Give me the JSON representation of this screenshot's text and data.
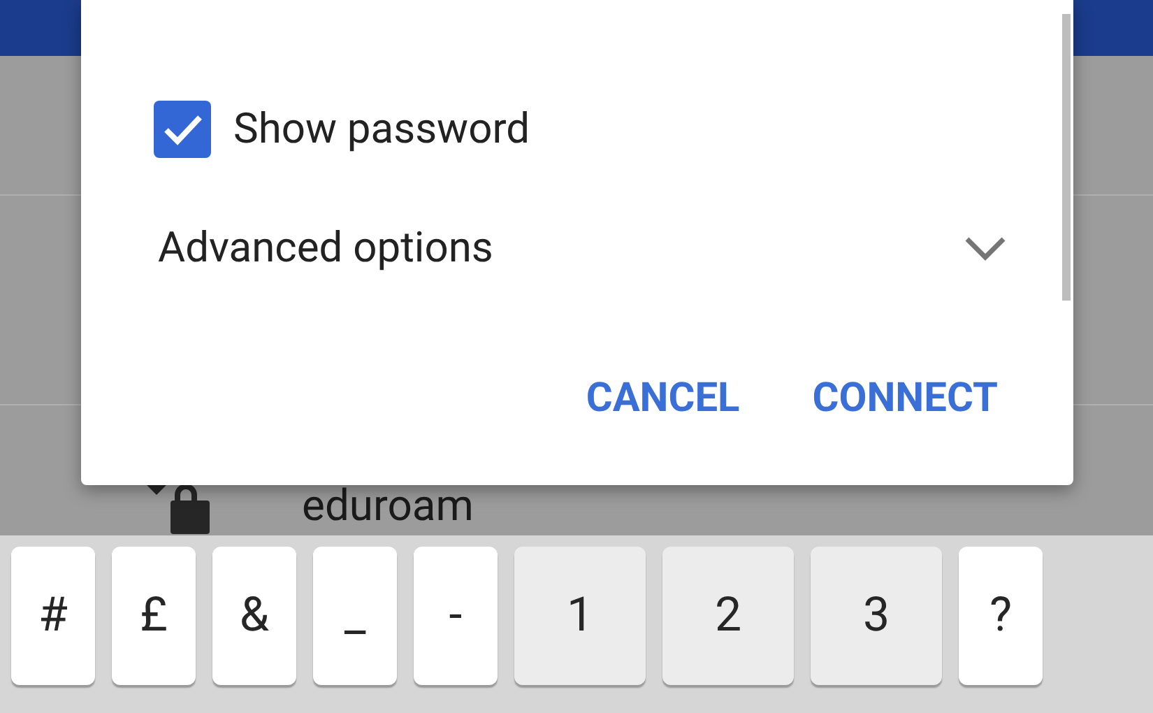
{
  "dialog": {
    "show_password": {
      "label": "Show password",
      "checked": true
    },
    "advanced_options": {
      "label": "Advanced options",
      "expanded": false
    },
    "buttons": [
      "CANCEL",
      "CONNECT"
    ]
  },
  "network_list": [
    {
      "name": "eduroam",
      "secured": true
    }
  ],
  "keyboard": {
    "keys": [
      {
        "label": "#",
        "kind": "symbol"
      },
      {
        "label": "£",
        "kind": "symbol"
      },
      {
        "label": "&",
        "kind": "symbol"
      },
      {
        "label": "_",
        "kind": "symbol"
      },
      {
        "label": "-",
        "kind": "symbol"
      },
      {
        "label": "1",
        "kind": "digit"
      },
      {
        "label": "2",
        "kind": "digit"
      },
      {
        "label": "3",
        "kind": "digit"
      },
      {
        "label": "?",
        "kind": "symbol"
      }
    ]
  }
}
